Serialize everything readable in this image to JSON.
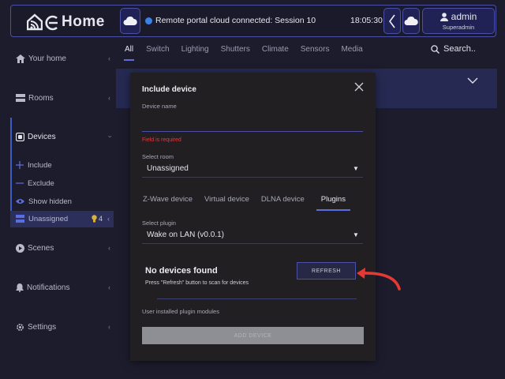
{
  "header": {
    "app_name": "Home",
    "status": "Remote portal cloud connected: Session 10",
    "time": "18:05:30",
    "user_name": "admin",
    "user_role": "Superadmin"
  },
  "sidebar": {
    "items": [
      {
        "label": "Your home"
      },
      {
        "label": "Rooms"
      },
      {
        "label": "Devices"
      },
      {
        "label": "Scenes"
      },
      {
        "label": "Notifications"
      },
      {
        "label": "Settings"
      }
    ],
    "sub_items": [
      {
        "label": "Include"
      },
      {
        "label": "Exclude"
      },
      {
        "label": "Show hidden"
      },
      {
        "label": "Unassigned"
      }
    ],
    "unassigned_count": "4"
  },
  "tabs": [
    "All",
    "Switch",
    "Lighting",
    "Shutters",
    "Climate",
    "Sensors",
    "Media"
  ],
  "search": {
    "label": "Search.."
  },
  "modal": {
    "title": "Include device",
    "device_name_label": "Device name",
    "device_name_value": "",
    "error": "Field is required",
    "room_label": "Select room",
    "room_value": "Unassigned",
    "tabs": [
      "Z-Wave device",
      "Virtual device",
      "DLNA device",
      "Plugins"
    ],
    "plugin_label": "Select plugin",
    "plugin_value": "Wake on LAN (v0.0.1)",
    "no_devices_title": "No devices found",
    "no_devices_hint": "Press \"Refresh\" button to scan for devices",
    "refresh_label": "REFRESH",
    "plugin_modules_label": "User installed plugin modules",
    "add_device_label": "ADD DEVICE"
  },
  "colors": {
    "background": "#1d1c2d",
    "accent": "#4b4fa6",
    "error": "#e5393b",
    "annotation_arrow": "#e53935"
  }
}
